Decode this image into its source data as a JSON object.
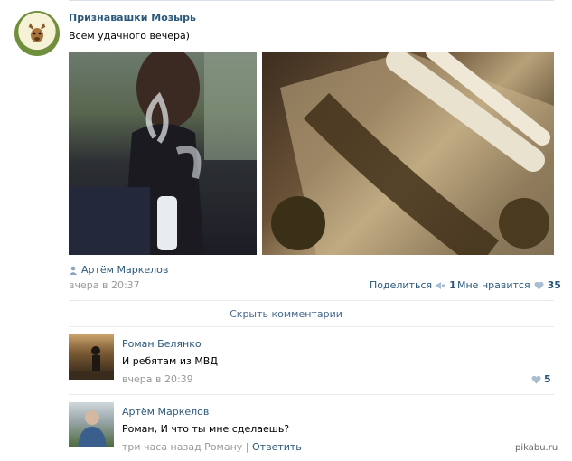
{
  "post": {
    "group_name": "Признавашки Мозырь",
    "text": "Всем удачного вечера)",
    "author": "Артём Маркелов",
    "date": "вчера в 20:37",
    "share_label": "Поделиться",
    "share_count": "1",
    "like_label": "Мне нравится",
    "like_count": "35"
  },
  "hide_comments_label": "Скрыть комментарии",
  "comments": [
    {
      "name": "Роман Белянко",
      "text": "И ребятам из МВД",
      "date": "вчера в 20:39",
      "likes": "5"
    },
    {
      "name": "Артём Маркелов",
      "text": "Роман, И что ты мне сделаешь?",
      "date": "три часа назад Роману",
      "reply_sep": "|",
      "reply_label": "Ответить"
    }
  ],
  "watermark": "pikabu.ru",
  "colors": {
    "link": "#2b587a",
    "meta": "#999999",
    "divider": "#e7ebf0"
  }
}
